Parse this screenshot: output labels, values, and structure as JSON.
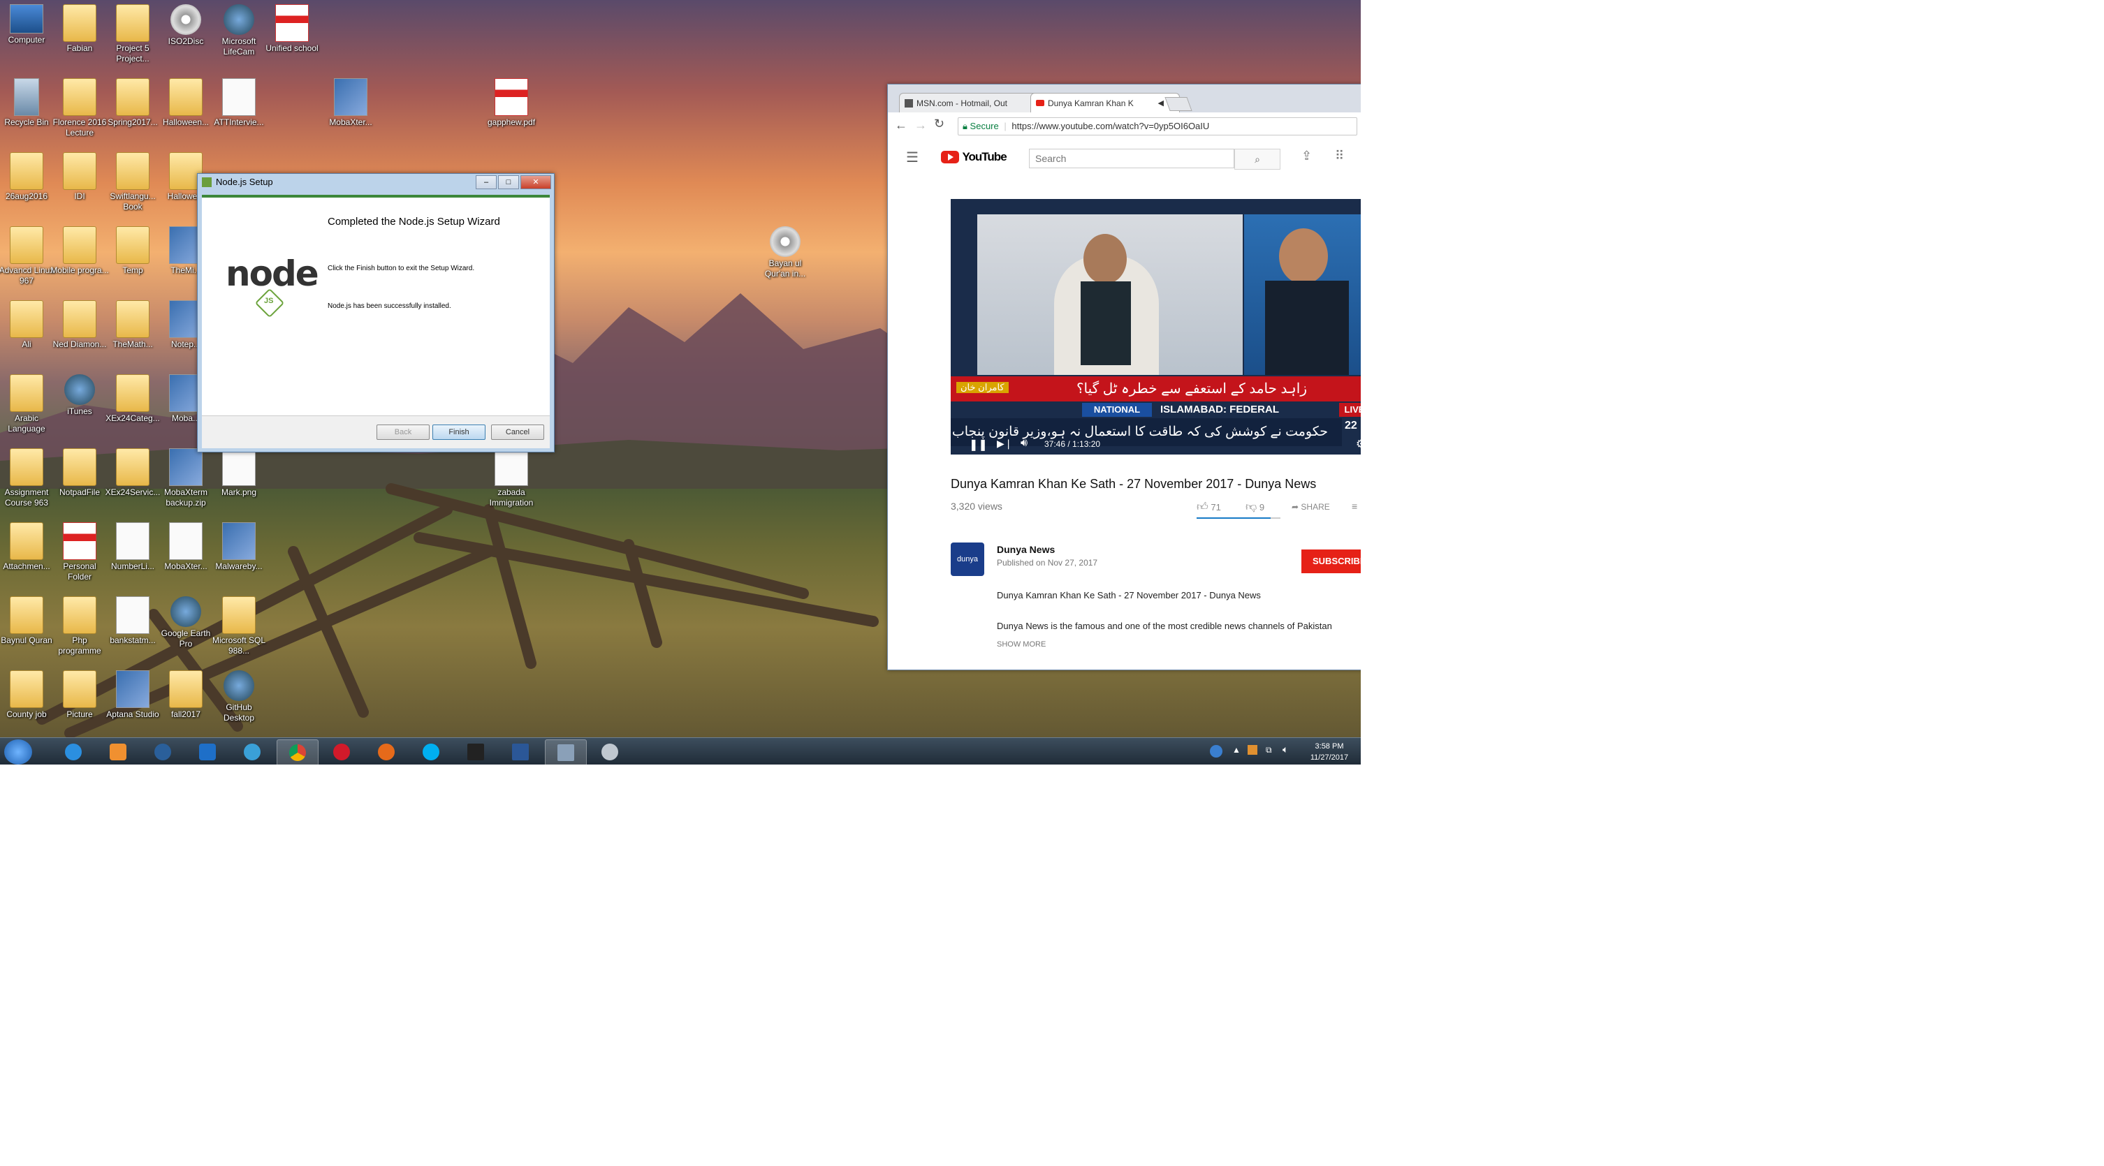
{
  "desktop": {
    "icons": [
      {
        "label": "Computer",
        "type": "computer"
      },
      {
        "label": "Fabian",
        "type": "folder"
      },
      {
        "label": "Project 5 Project...",
        "type": "folder"
      },
      {
        "label": "ISO2Disc",
        "type": "disc"
      },
      {
        "label": "Microsoft LifeCam",
        "type": "round"
      },
      {
        "label": "Unified school",
        "type": "pdf"
      },
      {
        "label": "Recycle Bin",
        "type": "bin"
      },
      {
        "label": "Florence 2016 Lecture",
        "type": "folder"
      },
      {
        "label": "Spring2017...",
        "type": "folder"
      },
      {
        "label": "Halloween...",
        "type": "folder"
      },
      {
        "label": "ATTInterviе...",
        "type": "doc"
      },
      {
        "label": "MobaXter...",
        "type": "app"
      },
      {
        "label": "gapphew.pdf",
        "type": "pdf"
      },
      {
        "label": "26aug2016",
        "type": "folder"
      },
      {
        "label": "IDI",
        "type": "folder"
      },
      {
        "label": "Swiftlangu... Book",
        "type": "folder"
      },
      {
        "label": "Hallowe...",
        "type": "folder"
      },
      {
        "label": "Advancd Linux 967",
        "type": "folder"
      },
      {
        "label": "Mobile progra...",
        "type": "folder"
      },
      {
        "label": "Temp",
        "type": "folder"
      },
      {
        "label": "TheMi...",
        "type": "app"
      },
      {
        "label": "Bayan ul Qur'an in...",
        "type": "disc"
      },
      {
        "label": "Ali",
        "type": "folder"
      },
      {
        "label": "Ned Diamon...",
        "type": "folder"
      },
      {
        "label": "TheMath...",
        "type": "folder"
      },
      {
        "label": "Notep...",
        "type": "app"
      },
      {
        "label": "Arabic Language",
        "type": "folder"
      },
      {
        "label": "iTunes",
        "type": "round"
      },
      {
        "label": "XEx24Categ...",
        "type": "folder"
      },
      {
        "label": "Moba...",
        "type": "app"
      },
      {
        "label": "Assignment Course 963",
        "type": "folder"
      },
      {
        "label": "NotpadFile",
        "type": "folder"
      },
      {
        "label": "XEx24Servic...",
        "type": "folder"
      },
      {
        "label": "MobaXterm backup.zip",
        "type": "app"
      },
      {
        "label": "Mark.png",
        "type": "doc"
      },
      {
        "label": "zabada Immigration",
        "type": "doc"
      },
      {
        "label": "Attachmen...",
        "type": "folder"
      },
      {
        "label": "Personal Folder",
        "type": "pdf"
      },
      {
        "label": "NumberLi...",
        "type": "doc"
      },
      {
        "label": "MobaXter...",
        "type": "doc"
      },
      {
        "label": "Malwareby...",
        "type": "app"
      },
      {
        "label": "Baynul Quran",
        "type": "folder"
      },
      {
        "label": "Php programme",
        "type": "folder"
      },
      {
        "label": "bankstatm...",
        "type": "doc"
      },
      {
        "label": "Google Earth Pro",
        "type": "round"
      },
      {
        "label": "Microsoft SQL 988...",
        "type": "folder"
      },
      {
        "label": "County job",
        "type": "folder"
      },
      {
        "label": "Picture",
        "type": "folder"
      },
      {
        "label": "Aptana Studio",
        "type": "app"
      },
      {
        "label": "fall2017",
        "type": "folder"
      },
      {
        "label": "GitHub Desktop",
        "type": "round"
      }
    ]
  },
  "node_dialog": {
    "title": "Node.js Setup",
    "heading": "Completed the Node.js Setup Wizard",
    "line1": "Click the Finish button to exit the Setup Wizard.",
    "line2": "Node.js has been successfully installed.",
    "logo_text": "node",
    "logo_sub": "JS",
    "back_label": "Back",
    "finish_label": "Finish",
    "cancel_label": "Cancel"
  },
  "browser": {
    "tabs": [
      {
        "label": "MSN.com - Hotmail, Out"
      },
      {
        "label": "Dunya Kamran Khan K"
      }
    ],
    "secure_label": "Secure",
    "url": "https://www.youtube.com/watch?v=0yp5OI6OaIU",
    "youtube": {
      "logo": "YouTube",
      "search_placeholder": "Search",
      "video_title": "Dunya Kamran Khan Ke Sath - 27 November 2017 - Dunya News",
      "views": "3,320 views",
      "likes": "71",
      "dislikes": "9",
      "share": "SHARE",
      "time": "37:46 / 1:13:20",
      "ticker_top": "زاہد حامد کے استعفے سے خطرہ ٹل گیا؟",
      "ticker_top_small": "کامران خان",
      "ticker_badge": "NATIONAL",
      "ticker_city": "ISLAMABAD: FEDERAL",
      "ticker_bottom": "حکومت نے کوشش کی کہ طاقت کا استعمال نہ ہو،وزیر قانون پنجاب",
      "channel_name": "Dunya News",
      "published": "Published on Nov 27, 2017",
      "subscribe": "SUBSCRIBE",
      "desc1": "Dunya Kamran Khan Ke Sath - 27 November 2017 - Dunya News",
      "desc2": "Dunya News is the famous and one of the most credible news channels of Pakistan",
      "show_more": "SHOW MORE",
      "live": "LIVE",
      "clock_num": "22"
    }
  },
  "taskbar": {
    "time": "3:58 PM",
    "date": "11/27/2017"
  }
}
